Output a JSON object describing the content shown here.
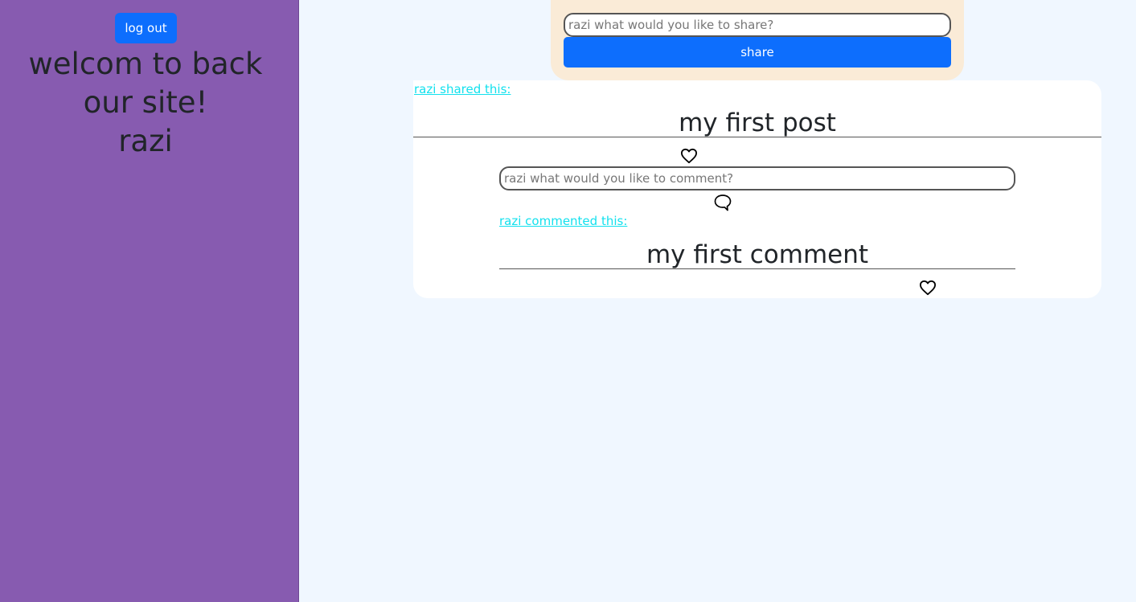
{
  "sidebar": {
    "logout_label": "log out",
    "welcome_line1": "welcom to back",
    "welcome_line2": "our site!",
    "username": "razi"
  },
  "share": {
    "placeholder": "razi what would you like to share?",
    "button_label": "share"
  },
  "post": {
    "author_link": "razi shared this:",
    "title": "my first post",
    "like_icon": "heart-icon",
    "comment_placeholder": "razi what would you like to comment?",
    "comment_icon": "speech-bubble-icon"
  },
  "comment": {
    "author_link": "razi commented this:",
    "text": "my first comment",
    "like_icon": "heart-icon"
  },
  "colors": {
    "sidebar_bg": "#875bb0",
    "page_bg": "#f0f7ff",
    "share_box_bg": "#faebd7",
    "primary_button": "#0d6efd",
    "link": "#13e1ee"
  }
}
